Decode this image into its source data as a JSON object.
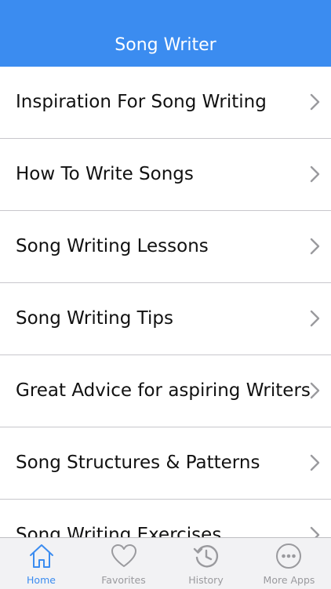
{
  "app": {
    "title": "Song Writer"
  },
  "list": {
    "items": [
      {
        "label": "Inspiration For Song Writing"
      },
      {
        "label": "How To Write Songs"
      },
      {
        "label": "Song Writing Lessons"
      },
      {
        "label": "Song Writing Tips"
      },
      {
        "label": "Great Advice for aspiring Writers"
      },
      {
        "label": "Song Structures & Patterns"
      },
      {
        "label": "Song Writing  Exercises"
      }
    ],
    "chevron_icon": "chevron-right-icon"
  },
  "tabbar": {
    "tabs": [
      {
        "label": "Home",
        "icon": "home-icon",
        "active": true
      },
      {
        "label": "Favorites",
        "icon": "heart-icon",
        "active": false
      },
      {
        "label": "History",
        "icon": "history-icon",
        "active": false
      },
      {
        "label": "More Apps",
        "icon": "more-icon",
        "active": false
      }
    ]
  },
  "colors": {
    "accent": "#3b8cf0",
    "separator": "#c8c7cc",
    "inactive": "#9a9a9e"
  }
}
